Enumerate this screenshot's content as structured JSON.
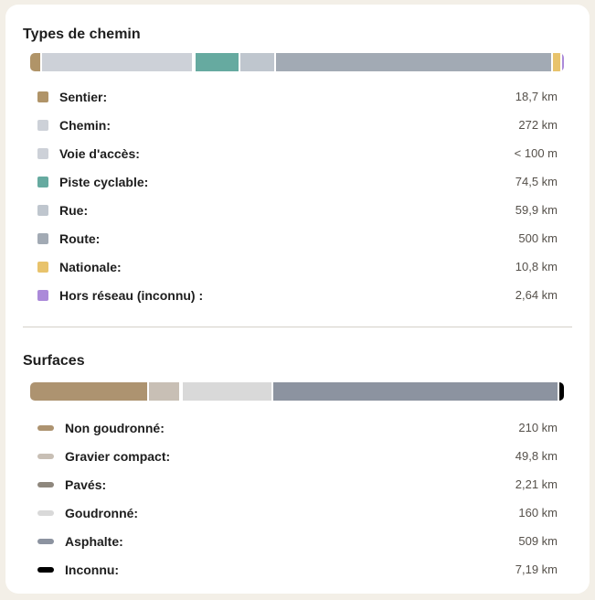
{
  "ways": {
    "title": "Types de chemin",
    "items": [
      {
        "label": "Sentier:",
        "value": "18,7 km",
        "color": "#b09468",
        "share": 1.9
      },
      {
        "label": "Chemin:",
        "value": "272 km",
        "color": "#cdd1d8",
        "share": 28.5
      },
      {
        "label": "Voie d'accès:",
        "value": "< 100 m",
        "color": "#cdd1d8",
        "share": 0.1
      },
      {
        "label": "Piste cyclable:",
        "value": "74,5 km",
        "color": "#66aaa0",
        "share": 8.2
      },
      {
        "label": "Rue:",
        "value": "59,9 km",
        "color": "#bfc6ce",
        "share": 6.3
      },
      {
        "label": "Route:",
        "value": "500 km",
        "color": "#a2aab4",
        "share": 52.3
      },
      {
        "label": "Nationale:",
        "value": "10,8 km",
        "color": "#e8c36c",
        "share": 1.3
      },
      {
        "label": "Hors réseau (inconnu) :",
        "value": "2,64 km",
        "color": "#ab8ad9",
        "share": 0.4
      }
    ]
  },
  "surfaces": {
    "title": "Surfaces",
    "items": [
      {
        "label": "Non goudronné:",
        "value": "210 km",
        "color": "#ad9370",
        "share": 22.0
      },
      {
        "label": "Gravier compact:",
        "value": "49,8 km",
        "color": "#c8bfb5",
        "share": 5.6
      },
      {
        "label": "Pavés:",
        "value": "2,21 km",
        "color": "#8e877d",
        "share": 0.2
      },
      {
        "label": "Goudronné:",
        "value": "160 km",
        "color": "#d9d9d9",
        "share": 16.7
      },
      {
        "label": "Asphalte:",
        "value": "509 km",
        "color": "#8c93a0",
        "share": 53.4
      },
      {
        "label": "Inconnu:",
        "value": "7,19 km",
        "color": "#000000",
        "share": 0.8
      }
    ]
  }
}
